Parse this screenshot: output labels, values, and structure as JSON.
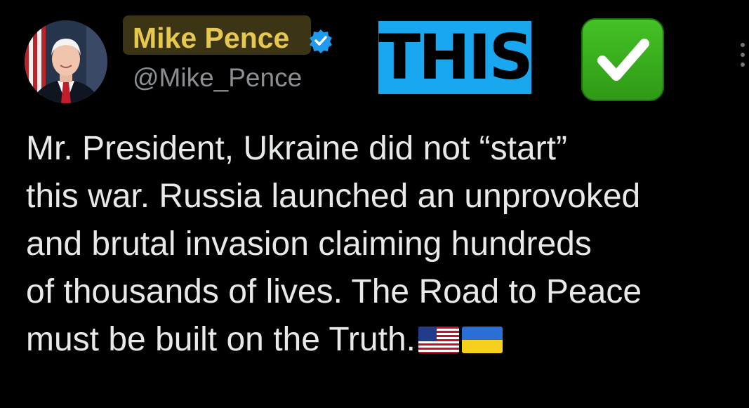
{
  "author": {
    "display_name": "Mike Pence",
    "handle": "@Mike_Pence",
    "avatar_icon": "profile-photo",
    "verified_icon": "verified-badge-icon"
  },
  "overlay": {
    "this_label": "THIS",
    "check_icon": "white-check-mark-icon"
  },
  "tweet": {
    "lines": [
      "Mr. President, Ukraine did not “start”",
      "this war. Russia launched an unprovoked",
      "and brutal invasion claiming hundreds",
      "of thousands of lives. The Road to Peace",
      "must be built on the Truth."
    ],
    "emojis": [
      "us-flag-icon",
      "ukraine-flag-icon"
    ]
  },
  "menu_icon": "more-options-icon",
  "colors": {
    "background": "#000000",
    "name_highlight": "#e6c84e",
    "handle": "#8b8f94",
    "text": "#e7e9ea",
    "this_badge": "#19a8f0",
    "check_badge": "#3caf1f",
    "verified": "#1d9bf0"
  }
}
